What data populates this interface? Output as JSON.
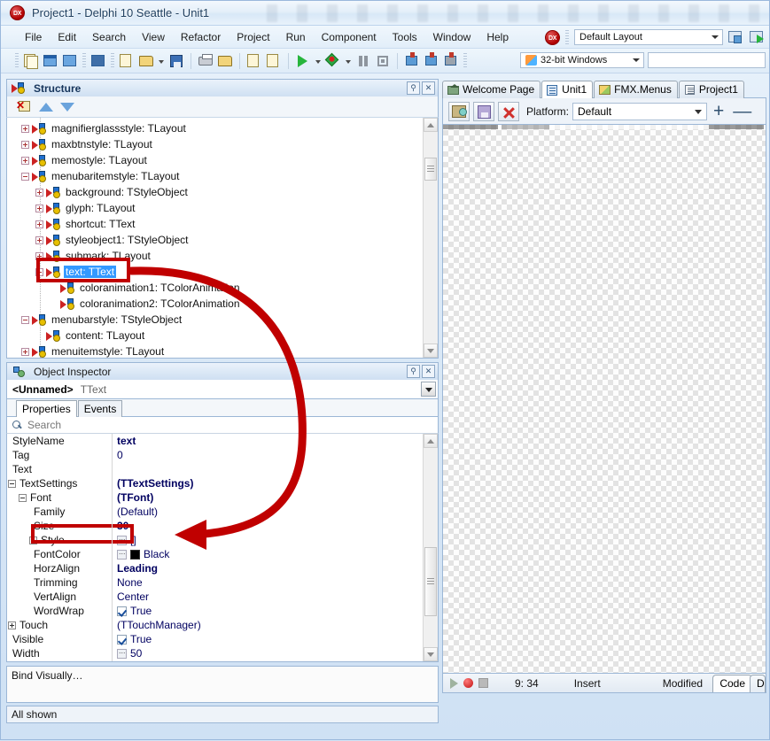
{
  "window": {
    "title": "Project1 - Delphi 10 Seattle - Unit1",
    "badge": "DX"
  },
  "menubar": {
    "items": [
      "File",
      "Edit",
      "Search",
      "View",
      "Refactor",
      "Project",
      "Run",
      "Component",
      "Tools",
      "Window",
      "Help"
    ],
    "layout_combo": "Default Layout"
  },
  "toolbar": {
    "platform_combo": "32-bit Windows",
    "search_value": ""
  },
  "structure": {
    "title": "Structure",
    "pin_icon": "pin-icon",
    "close_icon": "close-icon",
    "toolbar_icons": [
      "delete-icon",
      "move-up-icon",
      "move-down-icon"
    ],
    "tree": [
      {
        "label": "magnifierglassstyle: TLayout",
        "depth": 1,
        "expander": "plus"
      },
      {
        "label": "maxbtnstyle: TLayout",
        "depth": 1,
        "expander": "plus"
      },
      {
        "label": "memostyle: TLayout",
        "depth": 1,
        "expander": "plus"
      },
      {
        "label": "menubaritemstyle: TLayout",
        "depth": 1,
        "expander": "minus"
      },
      {
        "label": "background: TStyleObject",
        "depth": 2,
        "expander": "plus"
      },
      {
        "label": "glyph: TLayout",
        "depth": 2,
        "expander": "plus"
      },
      {
        "label": "shortcut: TText",
        "depth": 2,
        "expander": "plus"
      },
      {
        "label": "styleobject1: TStyleObject",
        "depth": 2,
        "expander": "plus"
      },
      {
        "label": "submark: TLayout",
        "depth": 2,
        "expander": "plus"
      },
      {
        "label": "text: TText",
        "depth": 2,
        "expander": "minus",
        "selected": true
      },
      {
        "label": "coloranimation1: TColorAnimation",
        "depth": 3,
        "expander": "none"
      },
      {
        "label": "coloranimation2: TColorAnimation",
        "depth": 3,
        "expander": "none"
      },
      {
        "label": "menubarstyle: TStyleObject",
        "depth": 1,
        "expander": "minus"
      },
      {
        "label": "content: TLayout",
        "depth": 2,
        "expander": "none"
      },
      {
        "label": "menuitemstyle: TLayout",
        "depth": 1,
        "expander": "plus"
      }
    ]
  },
  "object_inspector": {
    "title": "Object Inspector",
    "selected_name": "<Unnamed>",
    "selected_type": "TText",
    "tabs": [
      {
        "label": "Properties",
        "active": true
      },
      {
        "label": "Events",
        "active": false
      }
    ],
    "search_placeholder": "Search",
    "rows": [
      {
        "name": "StyleName",
        "value": "text",
        "indent": 0,
        "nest": "none",
        "style": "bold"
      },
      {
        "name": "Tag",
        "value": "0",
        "indent": 0,
        "nest": "none",
        "style": "plain"
      },
      {
        "name": "Text",
        "value": "",
        "indent": 0,
        "nest": "none",
        "style": "plain"
      },
      {
        "name": "TextSettings",
        "value": "(TTextSettings)",
        "indent": 0,
        "nest": "minus",
        "style": "bold"
      },
      {
        "name": "Font",
        "value": "(TFont)",
        "indent": 1,
        "nest": "minus",
        "style": "bold"
      },
      {
        "name": "Family",
        "value": "(Default)",
        "indent": 2,
        "nest": "none",
        "style": "plain"
      },
      {
        "name": "Size",
        "value": "30",
        "indent": 2,
        "nest": "none",
        "style": "bold",
        "highlight": true
      },
      {
        "name": "Style",
        "value": "[]",
        "indent": 2,
        "nest": "plus",
        "style": "plain",
        "widget": "ellipsis"
      },
      {
        "name": "FontColor",
        "value": "Black",
        "indent": 2,
        "nest": "none",
        "style": "plain",
        "widget": "color"
      },
      {
        "name": "HorzAlign",
        "value": "Leading",
        "indent": 2,
        "nest": "none",
        "style": "bold"
      },
      {
        "name": "Trimming",
        "value": "None",
        "indent": 2,
        "nest": "none",
        "style": "plain"
      },
      {
        "name": "VertAlign",
        "value": "Center",
        "indent": 2,
        "nest": "none",
        "style": "plain"
      },
      {
        "name": "WordWrap",
        "value": "True",
        "indent": 2,
        "nest": "none",
        "style": "plain",
        "widget": "check"
      },
      {
        "name": "Touch",
        "value": "(TTouchManager)",
        "indent": 0,
        "nest": "plus",
        "style": "plain"
      },
      {
        "name": "Visible",
        "value": "True",
        "indent": 0,
        "nest": "none",
        "style": "plain",
        "widget": "check"
      },
      {
        "name": "Width",
        "value": "50",
        "indent": 0,
        "nest": "none",
        "style": "plain",
        "widget": "ellipsis"
      }
    ],
    "bind_visually": "Bind Visually…",
    "status": "All shown"
  },
  "designer": {
    "doc_tabs": [
      {
        "label": "Welcome Page",
        "icon": "home-icon",
        "active": false
      },
      {
        "label": "Unit1",
        "icon": "unit-icon",
        "active": true
      },
      {
        "label": "FMX.Menus",
        "icon": "fmx-icon",
        "active": false
      },
      {
        "label": "Project1",
        "icon": "project-icon",
        "active": false
      }
    ],
    "toolbar": {
      "view_icon": "view-style-icon",
      "save_icon": "save-style-icon",
      "delete_icon": "delete-style-icon",
      "platform_label": "Platform:",
      "platform_value": "Default",
      "add_label": "+",
      "remove_label": "—"
    },
    "form_buttons": [
      {
        "name": "black-swatch-button",
        "fill": "black"
      },
      {
        "name": "white-swatch-button",
        "fill": "white"
      },
      {
        "name": "transparent-swatch-button",
        "fill": "transparent"
      }
    ]
  },
  "status_bar": {
    "cursor_position": "9: 34",
    "insert_mode": "Insert",
    "modified": "Modified",
    "tabs": [
      {
        "label": "Code",
        "active": true
      },
      {
        "label": "Design",
        "active": false
      }
    ]
  },
  "annotations": {
    "color": "#c00000",
    "highlight_tree_node": "text: TText",
    "highlight_property": "Size",
    "highlight_value": "30"
  }
}
